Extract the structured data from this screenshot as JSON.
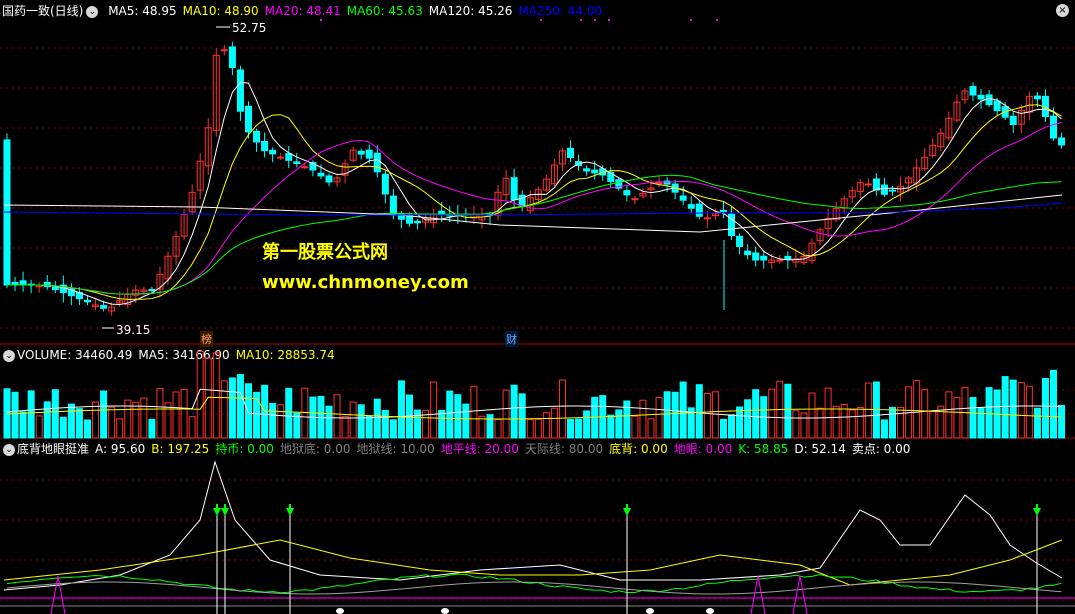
{
  "main": {
    "title": "国药一致(日线)",
    "ma_items": [
      {
        "label": "MA5: 48.95",
        "color": "#ffffff"
      },
      {
        "label": "MA10: 48.90",
        "color": "#ffff00"
      },
      {
        "label": "MA20: 48.41",
        "color": "#ff00ff"
      },
      {
        "label": "MA60: 45.63",
        "color": "#00ff00"
      },
      {
        "label": "MA120: 45.26",
        "color": "#ffffff"
      },
      {
        "label": "MA250: 44.00",
        "color": "#0000ff"
      }
    ],
    "high_label": "52.75",
    "low_label": "39.15",
    "tag_bang": "榜",
    "tag_cai": "财",
    "watermark_cn": "第一股票公式网",
    "watermark_url": "www.chnmoney.com"
  },
  "volume": {
    "items": [
      {
        "label": "VOLUME: 34460.49",
        "color": "#ffffff"
      },
      {
        "label": "MA5: 34166.90",
        "color": "#ffffff"
      },
      {
        "label": "MA10: 28853.74",
        "color": "#ffff00"
      }
    ]
  },
  "indicator": {
    "items": [
      {
        "label": "底背地眼挺准",
        "color": "#ffffff"
      },
      {
        "label": "A: 95.60",
        "color": "#ffffff"
      },
      {
        "label": "B: 197.25",
        "color": "#ffff00"
      },
      {
        "label": "持币: 0.00",
        "color": "#00ff00"
      },
      {
        "label": "地狱底: 0.00",
        "color": "#808080"
      },
      {
        "label": "地狱线: 10.00",
        "color": "#808080"
      },
      {
        "label": "地平线: 20.00",
        "color": "#ff00ff"
      },
      {
        "label": "天际线: 80.00",
        "color": "#808080"
      },
      {
        "label": "底背: 0.00",
        "color": "#ffff00"
      },
      {
        "label": "地眼: 0.00",
        "color": "#ff00ff"
      },
      {
        "label": "K: 58.85",
        "color": "#00ff00"
      },
      {
        "label": "D: 52.14",
        "color": "#ffffff"
      },
      {
        "label": "卖点: 0.00",
        "color": "#ffffff"
      }
    ]
  },
  "colors": {
    "up": "#ff3030",
    "down": "#00ffff",
    "grid": "#7a0000",
    "ma5": "#ffffff",
    "ma10": "#ffff00",
    "ma20": "#ff00ff",
    "ma60": "#00ff00",
    "ma120": "#ffffff",
    "ma250": "#0000ff"
  }
}
